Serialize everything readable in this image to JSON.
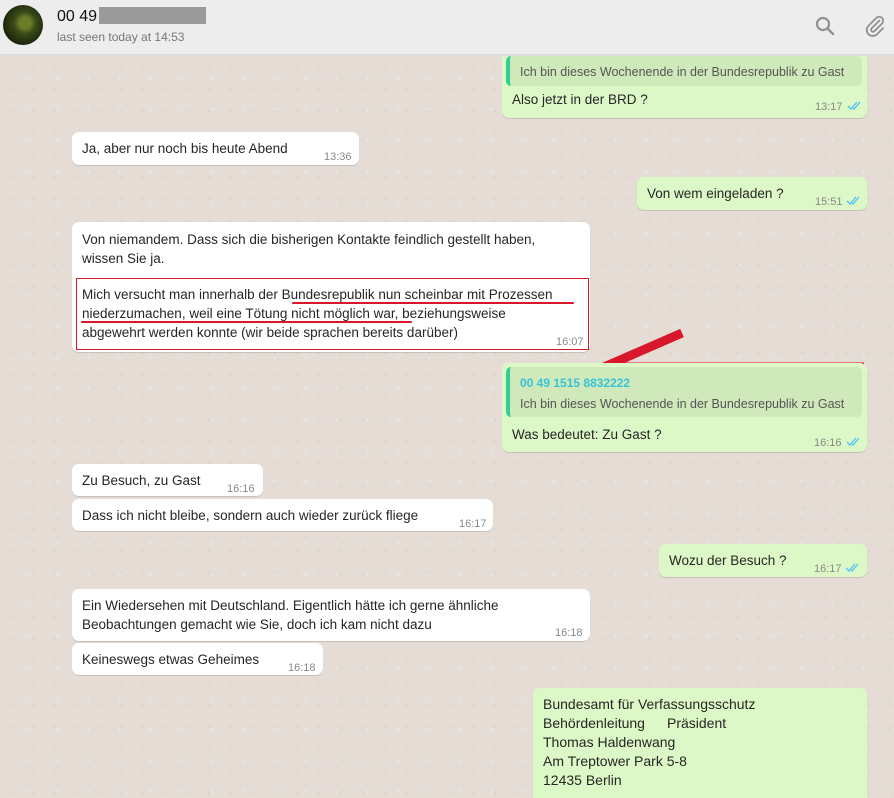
{
  "header": {
    "contact_name": "00 49",
    "last_seen": "last seen today at 14:53",
    "search_icon": "search-icon",
    "attach_icon": "paperclip-icon"
  },
  "messages": {
    "m1": {
      "quote_text": "Ich bin dieses Wochenende in der Bundesrepublik zu Gast",
      "text": "Also jetzt in der BRD ?",
      "time": "13:17"
    },
    "m2": {
      "text": "Ja, aber nur noch bis heute Abend",
      "time": "13:36"
    },
    "m3": {
      "text": "Von wem eingeladen ?",
      "time": "15:51"
    },
    "m4": {
      "line1": "Von niemandem. Dass sich die bisherigen Kontakte feindlich gestellt haben,",
      "line2": "wissen Sie ja.",
      "line3": "Mich versucht man innerhalb der Bundesrepublik nun scheinbar mit Prozessen",
      "line4": "niederzumachen, weil eine Tötung nicht möglich war, beziehungsweise",
      "line5": "abgewehrt werden konnte (wir beide sprachen bereits darüber)",
      "time": "16:07"
    },
    "m5": {
      "quote_number": "00 49 1515 8832222",
      "quote_text": "Ich bin dieses Wochenende in der Bundesrepublik zu Gast",
      "text": "Was bedeutet: Zu Gast ?",
      "time": "16:16"
    },
    "m6": {
      "text": "Zu Besuch, zu Gast",
      "time": "16:16"
    },
    "m7": {
      "text": "Dass ich nicht bleibe, sondern auch wieder zurück fliege",
      "time": "16:17"
    },
    "m8": {
      "text": "Wozu der Besuch ?",
      "time": "16:17"
    },
    "m9": {
      "line1": "Ein Wiedersehen mit Deutschland. Eigentlich hätte ich gerne ähnliche",
      "line2": "Beobachtungen gemacht wie Sie, doch ich kam nicht dazu",
      "time": "16:18"
    },
    "m10": {
      "text": "Keineswegs etwas Geheimes",
      "time": "16:18"
    },
    "m11": {
      "line1": "Bundesamt für Verfassungsschutz",
      "line2a": "Behördenleitung",
      "line2b": "Präsident",
      "line3": "Thomas Haldenwang",
      "line4": "Am Treptower Park 5-8",
      "line5": "12435 Berlin"
    }
  },
  "annotation": {
    "color": "#d8182a",
    "arrow_icon": "red-arrow-icon"
  },
  "colors": {
    "incoming": "#ffffff",
    "outgoing": "#dcf8c6",
    "read_ticks": "#4fc3f7",
    "quote_accent": "#35cd96"
  }
}
